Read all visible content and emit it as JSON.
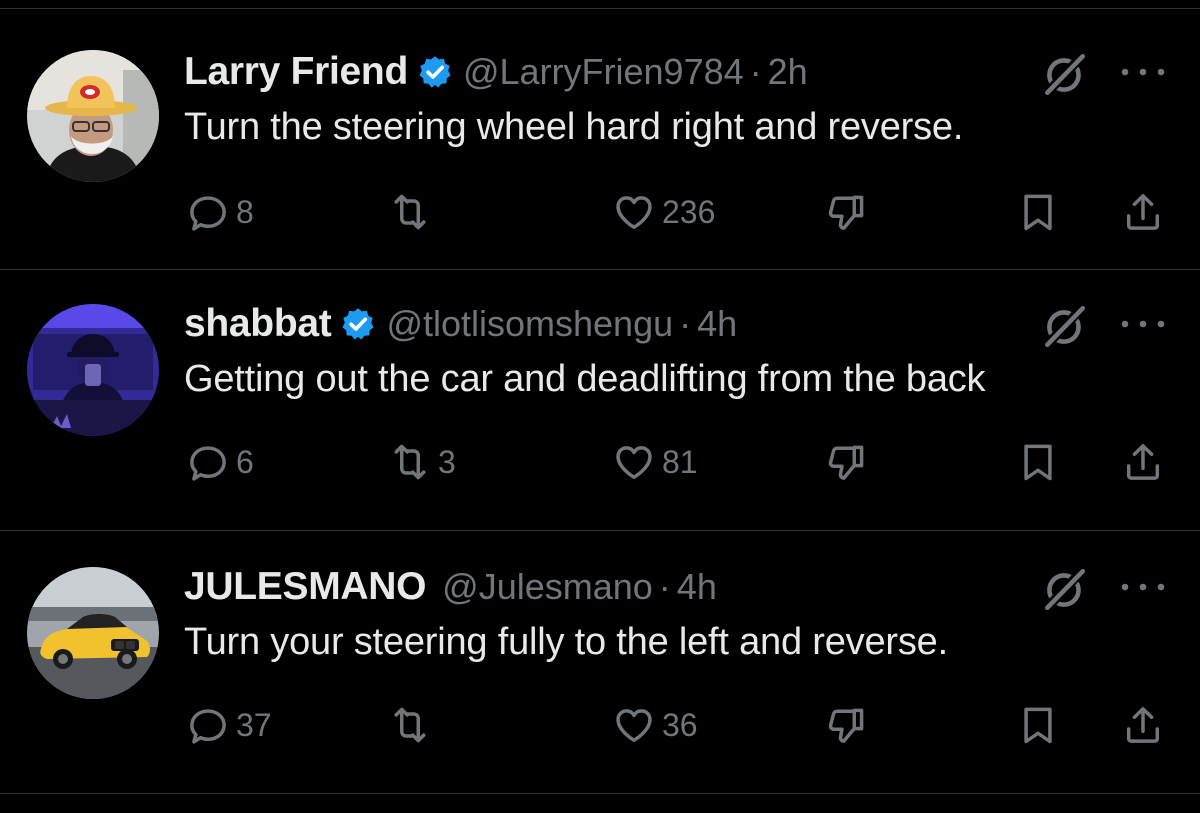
{
  "replies": [
    {
      "name": "Larry Friend",
      "verified": true,
      "handle": "@LarryFrien9784",
      "separator": "·",
      "time": "2h",
      "text": "Turn the steering wheel hard right and reverse.",
      "reply_count": "8",
      "retweet_count": "",
      "like_count": "236",
      "avatar": "man-in-cowboy-hat"
    },
    {
      "name": "shabbat",
      "verified": true,
      "handle": "@tlotlisomshengu",
      "separator": "·",
      "time": "4h",
      "text": "Getting out the car and deadlifting from the back",
      "reply_count": "6",
      "retweet_count": "3",
      "like_count": "81",
      "avatar": "purple-lit-person"
    },
    {
      "name": "JULESMANO",
      "verified": false,
      "handle": "@Julesmano",
      "separator": "·",
      "time": "4h",
      "text": "Turn your steering fully to the left and reverse.",
      "reply_count": "37",
      "retweet_count": "",
      "like_count": "36",
      "avatar": "yellow-car"
    }
  ],
  "colors": {
    "background": "#000000",
    "text": "#e7e9ea",
    "secondary": "#71767b",
    "divider": "#2f3336",
    "verified": "#1d9bf0"
  },
  "icons": [
    "reply-icon",
    "retweet-icon",
    "like-icon",
    "dislike-icon",
    "bookmark-icon",
    "share-icon",
    "grok-icon",
    "more-icon",
    "verified-badge-icon"
  ]
}
